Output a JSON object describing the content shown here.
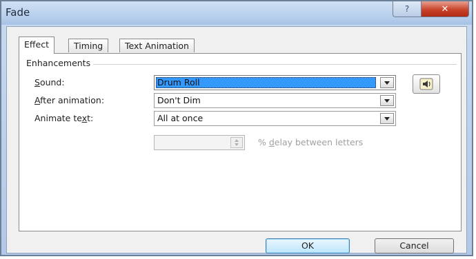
{
  "window": {
    "title": "Fade",
    "help_glyph": "?",
    "close_glyph": "✕"
  },
  "tabs": [
    {
      "label": "Effect",
      "active": true
    },
    {
      "label": "Timing",
      "active": false
    },
    {
      "label": "Text Animation",
      "active": false
    }
  ],
  "group": {
    "title": "Enhancements"
  },
  "sound": {
    "label_u": "S",
    "label_rest": "ound:",
    "value": "Drum Roll",
    "speaker_icon": "speaker-icon"
  },
  "after_animation": {
    "label_u": "A",
    "label_rest": "fter animation:",
    "value": "Don't Dim"
  },
  "animate_text": {
    "label_start": "Animate te",
    "label_u": "x",
    "label_rest": "t:",
    "value": "All at once"
  },
  "delay": {
    "value": "",
    "label_start": "% ",
    "label_u": "d",
    "label_rest": "elay between letters"
  },
  "buttons": {
    "ok": "OK",
    "cancel": "Cancel"
  },
  "colors": {
    "accent_highlight": "#3399ff",
    "close_red": "#c9432b"
  }
}
